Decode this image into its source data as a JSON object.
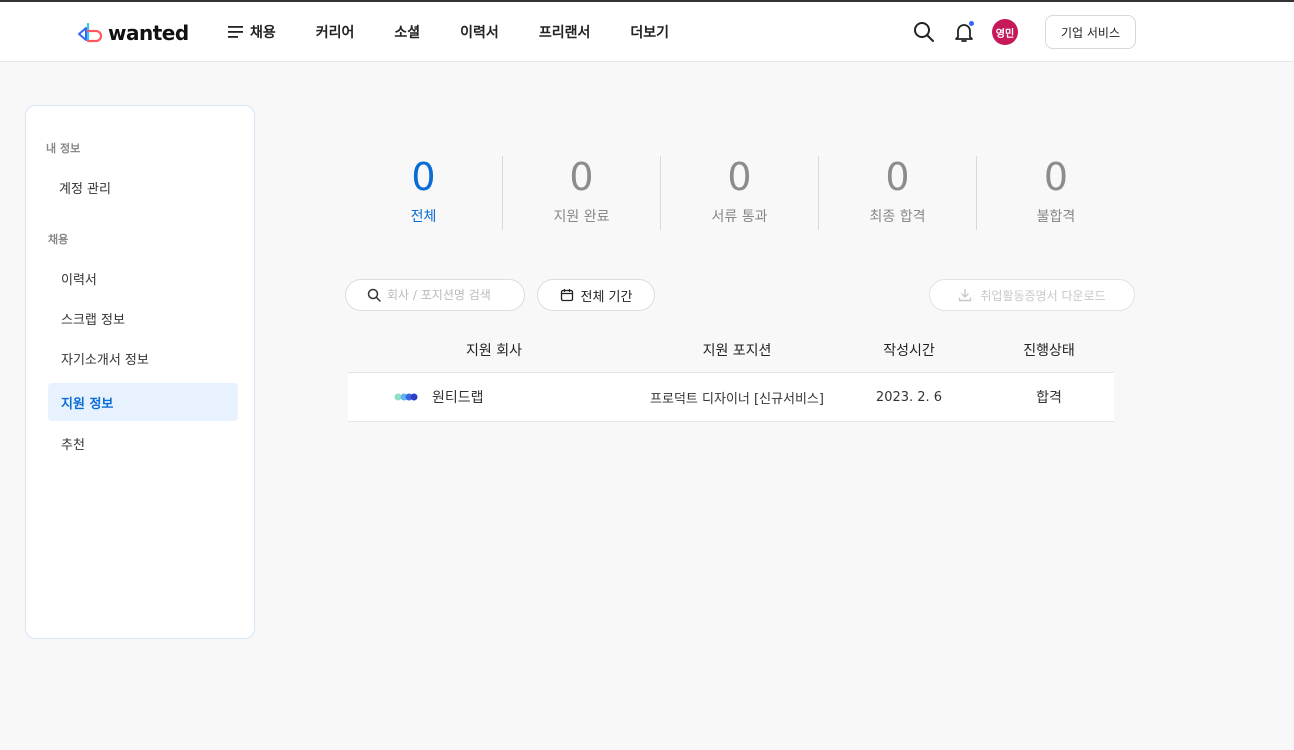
{
  "header": {
    "logo_text": "wanted",
    "nav": [
      "채용",
      "커리어",
      "소셜",
      "이력서",
      "프리랜서",
      "더보기"
    ],
    "avatar_text": "영민",
    "corp_button": "기업 서비스"
  },
  "sidebar": {
    "section_my": "내 정보",
    "account": "계정 관리",
    "section_recruit": "채용",
    "items": [
      "이력서",
      "스크랩 정보",
      "자기소개서 정보",
      "지원 정보",
      "추천"
    ],
    "active_item": "지원 정보"
  },
  "stats": [
    {
      "count": "0",
      "label": "전체",
      "active": true
    },
    {
      "count": "0",
      "label": "지원 완료"
    },
    {
      "count": "0",
      "label": "서류 통과"
    },
    {
      "count": "0",
      "label": "최종 합격"
    },
    {
      "count": "0",
      "label": "불합격"
    }
  ],
  "filters": {
    "search_placeholder": "회사 / 포지션명 검색",
    "period_label": "전체 기간",
    "download_label": "취업활동증명서 다운로드"
  },
  "table": {
    "headers": [
      "지원 회사",
      "지원 포지션",
      "작성시간",
      "진행상태"
    ],
    "rows": [
      {
        "company": "원티드랩",
        "position": "프로덕트 디자이너 [신규서비스]",
        "date": "2023. 2. 6",
        "status": "합격"
      }
    ]
  },
  "colors": {
    "accent": "#0a6cd6",
    "avatar_bg": "#c5195a",
    "active_bg": "#e8f2fe"
  },
  "icons": [
    "hamburger-icon",
    "search-icon",
    "bell-icon",
    "calendar-icon",
    "download-icon"
  ]
}
